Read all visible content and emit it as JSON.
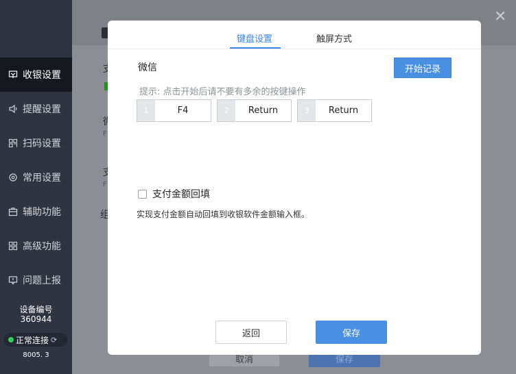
{
  "sidebar": {
    "items": [
      {
        "label": "收银设置",
        "icon": "cashier-icon",
        "active": true
      },
      {
        "label": "提醒设置",
        "icon": "speaker-icon",
        "active": false
      },
      {
        "label": "扫码设置",
        "icon": "scan-icon",
        "active": false
      },
      {
        "label": "常用设置",
        "icon": "gear-icon",
        "active": false
      },
      {
        "label": "辅助功能",
        "icon": "toolbox-icon",
        "active": false
      },
      {
        "label": "高级功能",
        "icon": "grid-icon",
        "active": false
      },
      {
        "label": "问题上报",
        "icon": "report-icon",
        "active": false
      }
    ],
    "device_label": "设备编号",
    "device_number": "360944",
    "status": "正常连接",
    "version": "8005. 3"
  },
  "background": {
    "row1_char": "支",
    "row2_char": "微",
    "row2_sub": "F",
    "row3_char": "支",
    "row3_sub": "F",
    "row4_char": "组",
    "cancel_label": "取消",
    "save_label": "保存"
  },
  "modal": {
    "tabs": [
      {
        "label": "键盘设置",
        "active": true
      },
      {
        "label": "触屏方式",
        "active": false
      }
    ],
    "section_title": "微信",
    "start_button": "开始记录",
    "hint": "提示:  点击开始后请不要有多余的按键操作",
    "keys": [
      {
        "index": "1",
        "value": "F4"
      },
      {
        "index": "2",
        "value": "Return"
      },
      {
        "index": "3",
        "value": "Return"
      }
    ],
    "checkbox_label": "支付金额回填",
    "description": "实现支付金额自动回填到收银软件金额输入框。",
    "back_button": "返回",
    "save_button": "保存"
  },
  "colors": {
    "accent": "#4a90e2",
    "sidebar": "#2f3540",
    "sidebar_active": "#15191f",
    "status_green": "#2fcf5a"
  }
}
